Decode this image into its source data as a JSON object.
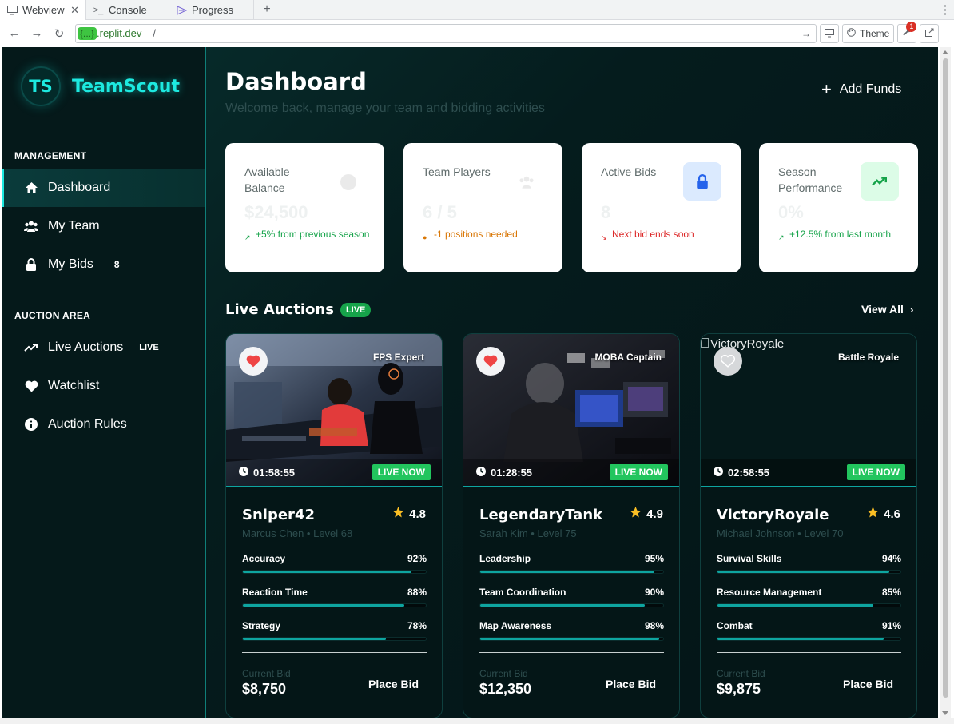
{
  "browser": {
    "tabs": [
      {
        "label": "Webview",
        "icon": "monitor-icon",
        "active": true
      },
      {
        "label": "Console",
        "icon": "terminal-icon",
        "active": false
      },
      {
        "label": "Progress",
        "icon": "progress-icon",
        "active": false
      }
    ],
    "url_badge": "{...}",
    "url_domain": ".replit.dev",
    "url_path": "/",
    "theme_label": "Theme",
    "notification_count": "1"
  },
  "sidebar": {
    "logo_initials": "TS",
    "logo_text": "TeamScout",
    "management_label": "MANAGEMENT",
    "management_items": [
      {
        "label": "Dashboard",
        "icon": "home-icon",
        "active": true
      },
      {
        "label": "My Team",
        "icon": "users-icon"
      },
      {
        "label": "My Bids",
        "icon": "lock-icon",
        "badge": "8"
      }
    ],
    "auction_label": "AUCTION AREA",
    "auction_items": [
      {
        "label": "Live Auctions",
        "icon": "trend-icon",
        "badge": "LIVE"
      },
      {
        "label": "Watchlist",
        "icon": "heart-icon"
      },
      {
        "label": "Auction Rules",
        "icon": "info-icon"
      }
    ]
  },
  "header": {
    "title": "Dashboard",
    "subtitle": "Welcome back, manage your team and bidding activities",
    "add_funds_label": "Add Funds"
  },
  "stats": [
    {
      "label": "Available Balance",
      "value": "$24,500",
      "note": "+5% from previous season",
      "note_color": "#16a34a",
      "icon": "dollar-icon"
    },
    {
      "label": "Team Players",
      "value": "6 / 5",
      "note": "-1 positions needed",
      "note_color": "#d97706",
      "icon": "users-icon"
    },
    {
      "label": "Active Bids",
      "value": "8",
      "note": "Next bid ends soon",
      "note_color": "#dc2626",
      "icon": "lock-icon"
    },
    {
      "label": "Season Performance",
      "value": "0%",
      "note": "+12.5% from last month",
      "note_color": "#16a34a",
      "icon": "trend-up-icon"
    }
  ],
  "auctions": {
    "heading": "Live Auctions",
    "live_pill": "LIVE",
    "view_all": "View All",
    "live_now_label": "LIVE NOW",
    "current_bid_label": "Current Bid",
    "place_bid_label": "Place Bid",
    "cards": [
      {
        "name": "Sniper42",
        "rating": "4.8",
        "meta": "Marcus Chen • Level 68",
        "role": "FPS Expert",
        "timer": "01:58:55",
        "bid": "$8,750",
        "favorited": true,
        "image_alt": "",
        "skills": [
          {
            "name": "Accuracy",
            "pct": "92%",
            "value": 92
          },
          {
            "name": "Reaction Time",
            "pct": "88%",
            "value": 88
          },
          {
            "name": "Strategy",
            "pct": "78%",
            "value": 78
          }
        ]
      },
      {
        "name": "LegendaryTank",
        "rating": "4.9",
        "meta": "Sarah Kim • Level 75",
        "role": "MOBA Captain",
        "timer": "01:28:55",
        "bid": "$12,350",
        "favorited": true,
        "image_alt": "",
        "skills": [
          {
            "name": "Leadership",
            "pct": "95%",
            "value": 95
          },
          {
            "name": "Team Coordination",
            "pct": "90%",
            "value": 90
          },
          {
            "name": "Map Awareness",
            "pct": "98%",
            "value": 98
          }
        ]
      },
      {
        "name": "VictoryRoyale",
        "rating": "4.6",
        "meta": "Michael Johnson • Level 70",
        "role": "Battle Royale",
        "timer": "02:58:55",
        "bid": "$9,875",
        "favorited": false,
        "image_alt": "VictoryRoyale",
        "skills": [
          {
            "name": "Survival Skills",
            "pct": "94%",
            "value": 94
          },
          {
            "name": "Resource Management",
            "pct": "85%",
            "value": 85
          },
          {
            "name": "Combat",
            "pct": "91%",
            "value": 91
          }
        ]
      }
    ]
  },
  "colors": {
    "accent": "#1de9e0",
    "progress": "#0ea5a0",
    "live_green": "#22c55e",
    "heart_red": "#ef4444",
    "star": "#fbbf24"
  }
}
